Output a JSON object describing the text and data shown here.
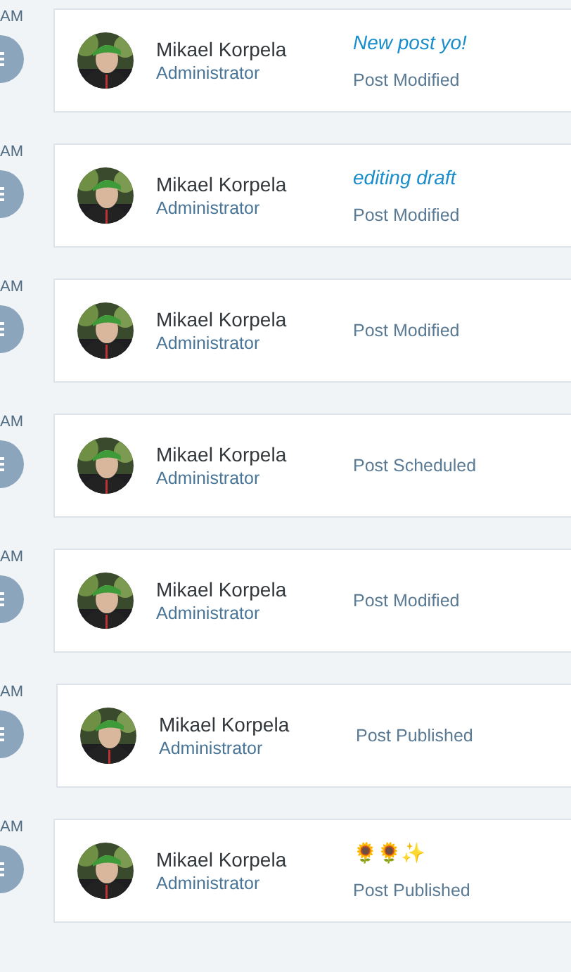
{
  "entries": [
    {
      "time": "AM",
      "user": "Mikael Korpela",
      "role": "Administrator",
      "note": {
        "kind": "link",
        "text": "New post yo!"
      },
      "action": "Post Modified"
    },
    {
      "time": "AM",
      "user": "Mikael Korpela",
      "role": "Administrator",
      "note": {
        "kind": "link",
        "text": "editing draft"
      },
      "action": "Post Modified"
    },
    {
      "time": "AM",
      "user": "Mikael Korpela",
      "role": "Administrator",
      "action": "Post Modified"
    },
    {
      "time": "AM",
      "user": "Mikael Korpela",
      "role": "Administrator",
      "action": "Post Scheduled"
    },
    {
      "time": "AM",
      "user": "Mikael Korpela",
      "role": "Administrator",
      "action": "Post Modified"
    },
    {
      "time": "AM",
      "user": "Mikael Korpela",
      "role": "Administrator",
      "action": "Post Published"
    },
    {
      "time": "AM",
      "user": "Mikael Korpela",
      "role": "Administrator",
      "note": {
        "kind": "emoji",
        "text": "🌻🌻✨"
      },
      "action": "Post Published"
    }
  ]
}
